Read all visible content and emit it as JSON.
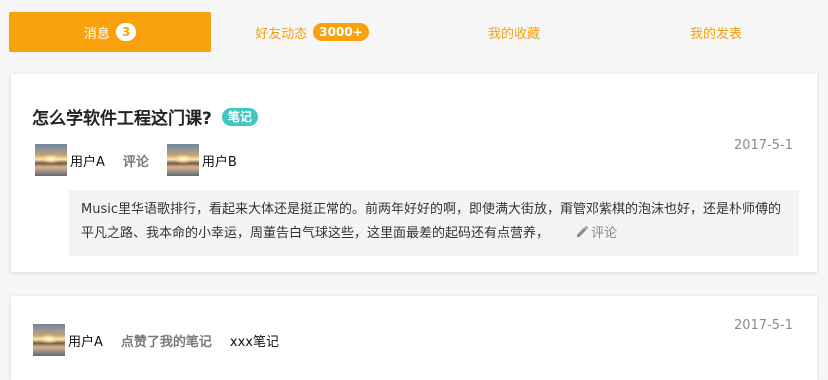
{
  "tabs": [
    {
      "label": "消息",
      "badge": "3",
      "active": true
    },
    {
      "label": "好友动态",
      "badge": "3000+",
      "active": false
    },
    {
      "label": "我的收藏",
      "badge": "",
      "active": false
    },
    {
      "label": "我的发表",
      "badge": "",
      "active": false
    }
  ],
  "card1": {
    "title": "怎么学软件工程这门课?",
    "tag": "笔记",
    "user_a": "用户A",
    "action": "评论",
    "user_b": "用户B",
    "date": "2017-5-1",
    "comment": "Music里华语歌排行，看起来大体还是挺正常的。前两年好好的啊，即使满大街放，甭管邓紫棋的泡沫也好，还是朴师傅的平凡之路、我本命的小幸运，周董告白气球这些，这里面最差的起码还有点营养，",
    "reply_label": "评论"
  },
  "card2": {
    "user_a": "用户A",
    "action": "点赞了我的笔记",
    "note": "xxx笔记",
    "date": "2017-5-1"
  },
  "colors": {
    "accent": "#f9a20d",
    "tag": "#3fc7c1"
  }
}
